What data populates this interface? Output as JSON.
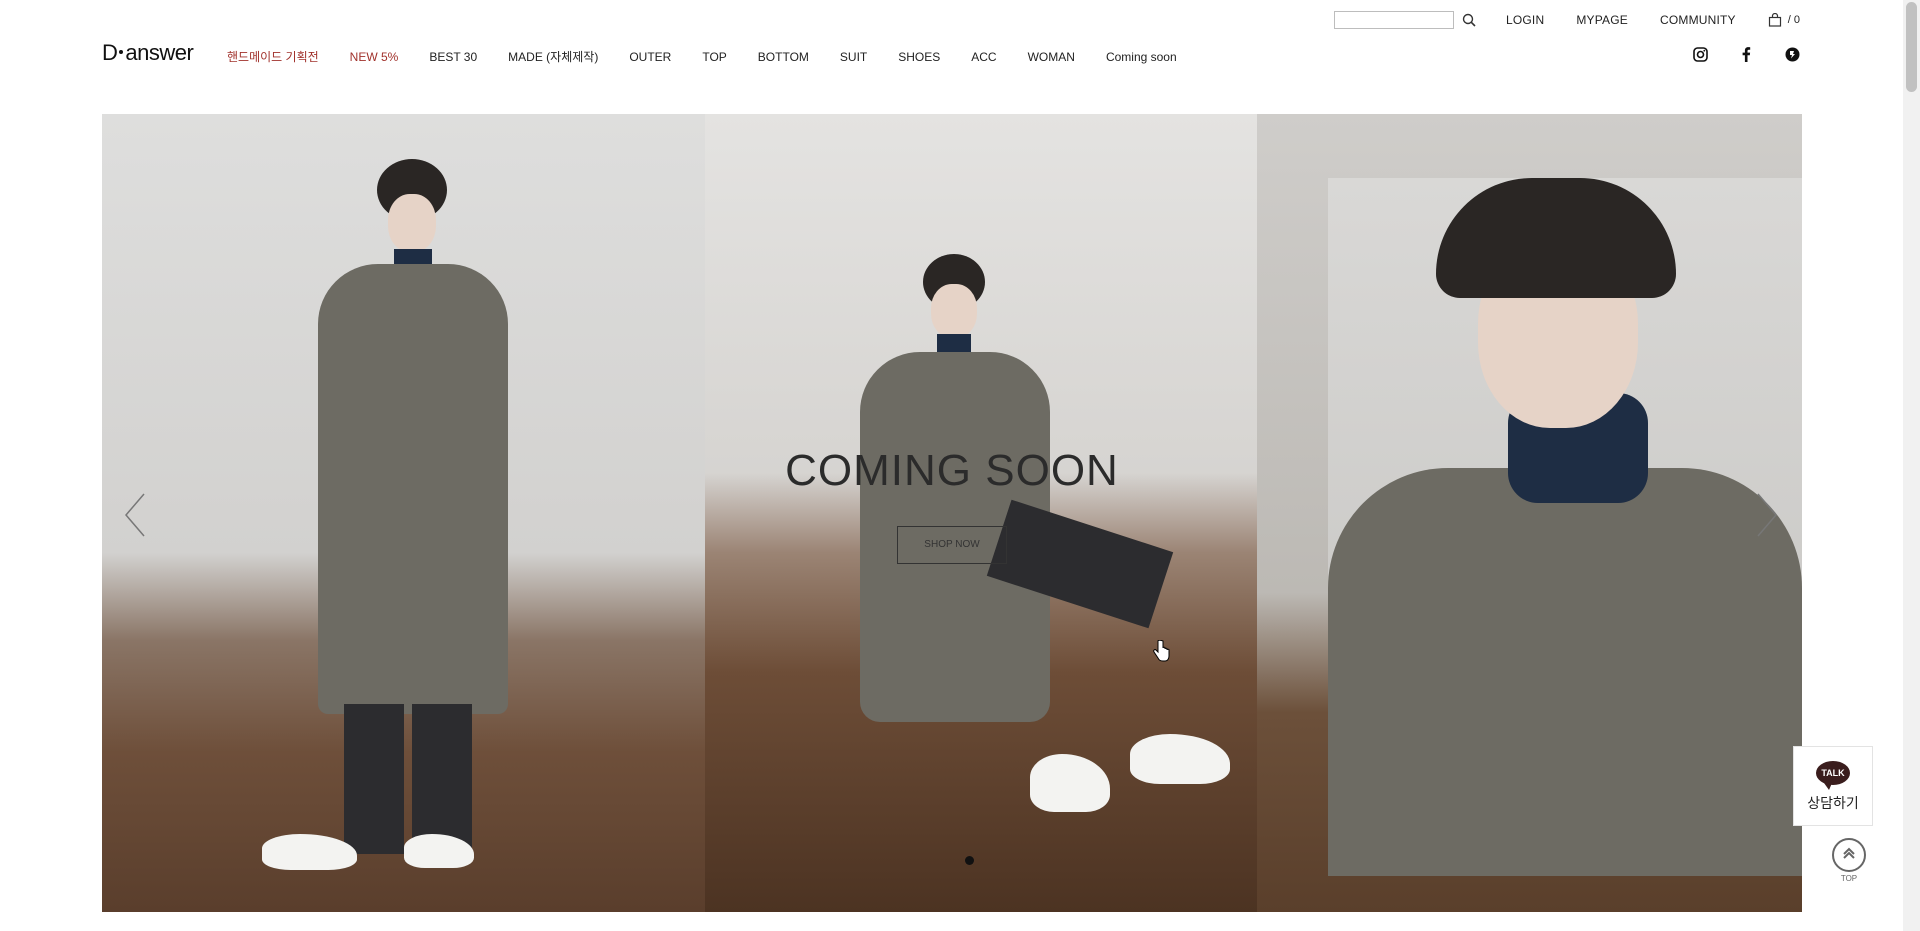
{
  "header": {
    "brand": {
      "before": "D",
      "after": "answer"
    },
    "search": {
      "placeholder": "",
      "value": ""
    },
    "util_links": {
      "login": "LOGIN",
      "mypage": "MYPAGE",
      "community": "COMMUNITY"
    },
    "cart": {
      "count": "/ 0"
    },
    "nav": [
      {
        "label": "핸드메이드 기획전"
      },
      {
        "label": "NEW 5%"
      },
      {
        "label": "BEST 30"
      },
      {
        "label": "MADE (자체제작)"
      },
      {
        "label": "OUTER"
      },
      {
        "label": "TOP"
      },
      {
        "label": "BOTTOM"
      },
      {
        "label": "SUIT"
      },
      {
        "label": "SHOES"
      },
      {
        "label": "ACC"
      },
      {
        "label": "WOMAN"
      },
      {
        "label": "Coming soon"
      }
    ],
    "social": [
      "instagram-icon",
      "facebook-icon",
      "kakaostory-icon"
    ]
  },
  "hero": {
    "title": "COMING SOON",
    "subtitle": "",
    "button": "SHOP NOW",
    "active_slide": 1,
    "slide_count": 1
  },
  "widgets": {
    "talk_bubble": "TALK",
    "talk_label": "상담하기",
    "top_label": "TOP"
  },
  "colors": {
    "accent_red": "#a1322c",
    "text": "#222222"
  }
}
